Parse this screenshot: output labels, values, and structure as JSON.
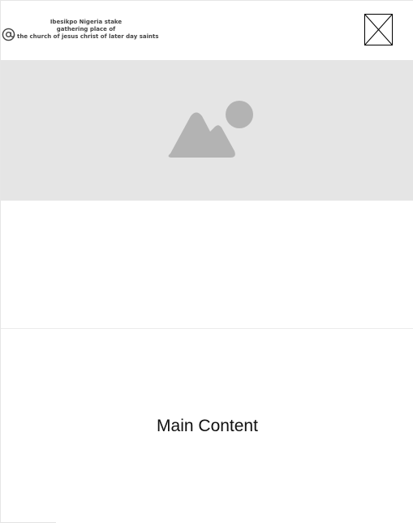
{
  "header": {
    "logo_icon": "at-sign-icon",
    "site_name_lines": [
      "Ibesikpo Nigeria stake",
      "gathering place of",
      "the church of jesus christ of later day saints"
    ],
    "menu_icon": "image-placeholder-x-icon"
  },
  "hero": {
    "icon": "image-placeholder-icon",
    "background_color": "#e5e5e5",
    "icon_color": "#b3b3b3"
  },
  "main": {
    "label": "Main Content"
  }
}
